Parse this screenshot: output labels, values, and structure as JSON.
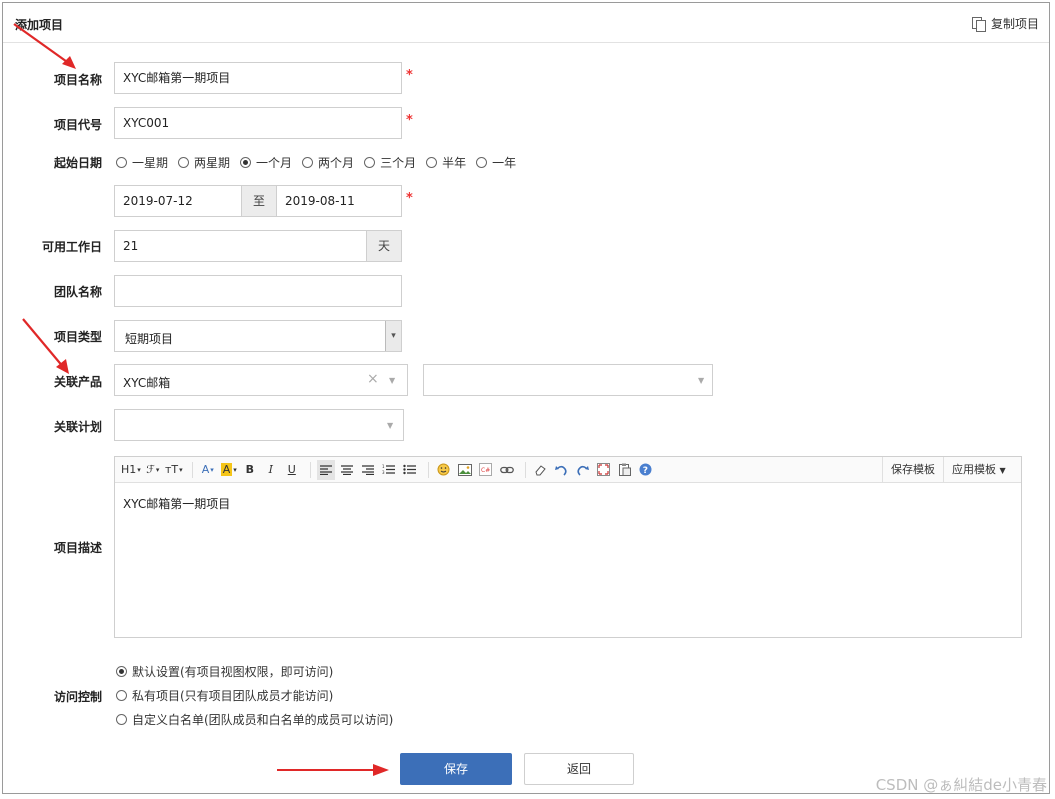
{
  "header": {
    "title": "添加项目",
    "copy_label": "复制项目"
  },
  "fields": {
    "name": {
      "label": "项目名称",
      "value": "XYC邮箱第一期项目"
    },
    "code": {
      "label": "项目代号",
      "value": "XYC001"
    },
    "date": {
      "label": "起始日期",
      "options": [
        "一星期",
        "两星期",
        "一个月",
        "两个月",
        "三个月",
        "半年",
        "一年"
      ],
      "selected": "一个月",
      "start": "2019-07-12",
      "separator": "至",
      "end": "2019-08-11"
    },
    "workdays": {
      "label": "可用工作日",
      "value": "21",
      "unit": "天"
    },
    "team": {
      "label": "团队名称",
      "value": ""
    },
    "type": {
      "label": "项目类型",
      "value": "短期项目"
    },
    "product": {
      "label": "关联产品",
      "value": "XYC邮箱",
      "clear": "×",
      "second_value": ""
    },
    "plan": {
      "label": "关联计划",
      "value": ""
    },
    "description": {
      "label": "项目描述",
      "content": "XYC邮箱第一期项目",
      "save_template": "保存模板",
      "apply_template": "应用模板"
    },
    "access": {
      "label": "访问控制",
      "options": [
        "默认设置(有项目视图权限，即可访问)",
        "私有项目(只有项目团队成员才能访问)",
        "自定义白名单(团队成员和白名单的成员可以访问)"
      ],
      "selected_index": 0
    }
  },
  "toolbar": {
    "heading": "H1",
    "font": "ℱ",
    "size": "тT",
    "font_color": "A",
    "bg_color": "A",
    "bold": "B",
    "italic": "I",
    "underline": "U"
  },
  "buttons": {
    "save": "保存",
    "back": "返回"
  },
  "watermark": "CSDN @ぁ糾結de小青春",
  "colors": {
    "primary": "#3c6fb8",
    "required": "#e33333",
    "arrow": "#e02828"
  }
}
